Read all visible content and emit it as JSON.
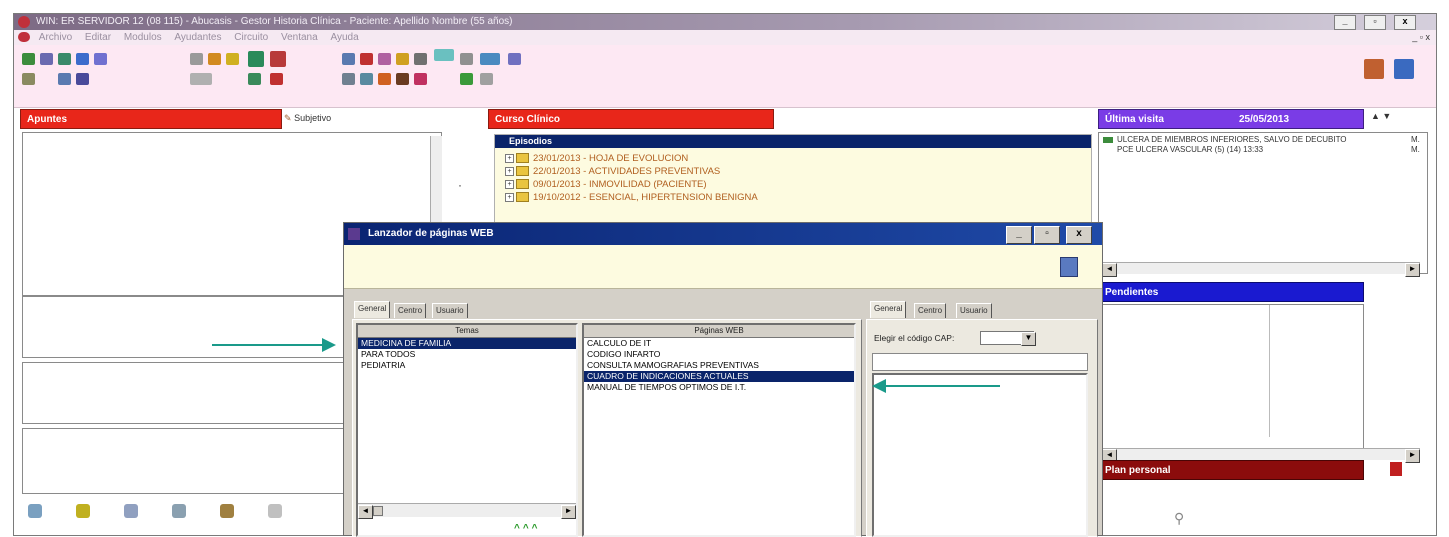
{
  "window": {
    "title": "WIN: ER SERVIDOR 12 (08 115) - Abucasis - Gestor Historia Clínica - Paciente: Apellido Nombre (55 años)",
    "btn_min": "_",
    "btn_max": "▫",
    "btn_close": "x",
    "mdi_controls": "_ ▫ x"
  },
  "menubar": {
    "items": [
      "Archivo",
      "Editar",
      "Modulos",
      "Ayudantes",
      "Circuito",
      "Ventana",
      "Ayuda"
    ]
  },
  "panels": {
    "apuntes": {
      "title": "Apuntes",
      "tab_label": "Subjetivo"
    },
    "curso_clinico": {
      "title": "Curso Clínico",
      "header": "Episodios",
      "items": [
        "23/01/2013 - HOJA DE EVOLUCION",
        "22/01/2013 - ACTIVIDADES PREVENTIVAS",
        "09/01/2013 - INMOVILIDAD (PACIENTE)",
        "19/10/2012 - ESENCIAL, HIPERTENSION BENIGNA"
      ]
    },
    "ultima_visita": {
      "title": "Última visita",
      "date": "25/05/2013",
      "line1": "ULCERA DE MIEMBROS INFERIORES, SALVO DE DECUBITO",
      "line2": "PCE ULCERA VASCULAR (5) (14) 13:33",
      "side1": "M.",
      "side2": "M."
    },
    "pendientes": {
      "title": "Pendientes"
    },
    "plan_personal": {
      "title": "Plan personal"
    }
  },
  "dialog": {
    "title": "Lanzador de páginas WEB",
    "btn_min": "_",
    "btn_max": "▫",
    "btn_close": "x",
    "left_tabs": [
      "General",
      "Centro",
      "Usuario"
    ],
    "right_tabs": [
      "General",
      "Centro",
      "Usuario"
    ],
    "col_temas": {
      "header": "Temas",
      "rows": [
        "MEDICINA DE FAMILIA",
        "PARA TODOS",
        "PEDIATRIA"
      ],
      "selected_index": 0
    },
    "col_paginas": {
      "header": "Páginas WEB",
      "rows": [
        "CALCULO DE IT",
        "CODIGO INFARTO",
        "CONSULTA MAMOGRAFIAS PREVENTIVAS",
        "CUADRO DE INDICACIONES ACTUALES",
        "MANUAL DE TIEMPOS OPTIMOS DE I.T."
      ],
      "selected_index": 3
    },
    "cap_label": "Elegir el código CAP:",
    "cap_value": "",
    "scroll_left": "◄",
    "scroll_right": "►"
  },
  "colors": {
    "arrow": "#1a9a8a",
    "apuntes_header": "#e8261a",
    "ultima_visita_header": "#7a3ce6",
    "pendientes_header": "#1a1ad0",
    "plan_personal_header": "#8b0c0c",
    "selection": "#0a246a",
    "toolbar_bg": "#fde8f3"
  },
  "icons": {
    "toolbar": [
      "cerrar-icon",
      "paciente-icon",
      "informes-icon",
      "agenda-icon",
      "documento-icon",
      "lapiz-icon",
      "editar-icon",
      "aprobar-icon",
      "grupo-icon",
      "grupo2-icon",
      "alergias-icon",
      "archivo-icon",
      "vacunas-icon",
      "mensaje-icon",
      "calendario-icon",
      "web-icon",
      "herramientas-icon",
      "pantalla-icon",
      "firma-icon"
    ],
    "bottom": [
      "instrumentos-icon",
      "hoja-icon",
      "pulgar-icon",
      "fonendo-icon",
      "sello-icon",
      "lapiz-icon"
    ]
  }
}
